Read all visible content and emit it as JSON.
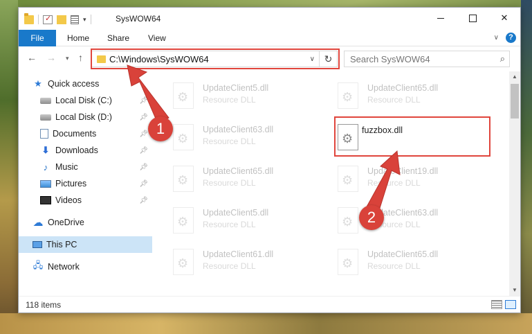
{
  "window": {
    "title": "SysWOW64",
    "controls": {
      "close_glyph": "✕"
    }
  },
  "ribbon": {
    "tabs": [
      {
        "label": "File"
      },
      {
        "label": "Home"
      },
      {
        "label": "Share"
      },
      {
        "label": "View"
      }
    ],
    "help_glyph": "?"
  },
  "navigation": {
    "address_path": "C:\\Windows\\SysWOW64",
    "search_placeholder": "Search SysWOW64"
  },
  "sidebar": {
    "items": [
      {
        "label": "Quick access",
        "icon": "star-icon",
        "pinned": false
      },
      {
        "label": "Local Disk (C:)",
        "icon": "disk-icon",
        "pinned": true
      },
      {
        "label": "Local Disk (D:)",
        "icon": "disk-icon",
        "pinned": true
      },
      {
        "label": "Documents",
        "icon": "documents-icon",
        "pinned": true
      },
      {
        "label": "Downloads",
        "icon": "downloads-icon",
        "pinned": true
      },
      {
        "label": "Music",
        "icon": "music-icon",
        "pinned": true
      },
      {
        "label": "Pictures",
        "icon": "pictures-icon",
        "pinned": true
      },
      {
        "label": "Videos",
        "icon": "videos-icon",
        "pinned": true
      },
      {
        "label": "OneDrive",
        "icon": "cloud-icon",
        "pinned": false
      },
      {
        "label": "This PC",
        "icon": "computer-icon",
        "pinned": false,
        "selected": true
      },
      {
        "label": "Network",
        "icon": "network-icon",
        "pinned": false
      }
    ]
  },
  "files": {
    "items": [
      {
        "name": "UpdateClient5.dll",
        "type": "Resource DLL",
        "faded": true
      },
      {
        "name": "UpdateClient65.dll",
        "type": "Resource DLL",
        "faded": true
      },
      {
        "name": "UpdateClient63.dll",
        "type": "Resource DLL",
        "faded": true
      },
      {
        "name": "fuzzbox.dll",
        "type": "",
        "faded": false
      },
      {
        "name": "UpdateClient65.dll",
        "type": "Resource DLL",
        "faded": true
      },
      {
        "name": "UpdateClient19.dll",
        "type": "Resource DLL",
        "faded": true
      },
      {
        "name": "UpdateClient5.dll",
        "type": "Resource DLL",
        "faded": true
      },
      {
        "name": "UpdateClient63.dll",
        "type": "Resource DLL",
        "faded": true
      },
      {
        "name": "UpdateClient61.dll",
        "type": "Resource DLL",
        "faded": true
      },
      {
        "name": "UpdateClient65.dll",
        "type": "Resource DLL",
        "faded": true
      }
    ]
  },
  "status": {
    "item_count": "118 items"
  },
  "annotations": {
    "marker_1": "1",
    "marker_2": "2",
    "color": "#d9423a"
  },
  "colors": {
    "accent": "#1979ca",
    "selection": "#cce4f7"
  }
}
